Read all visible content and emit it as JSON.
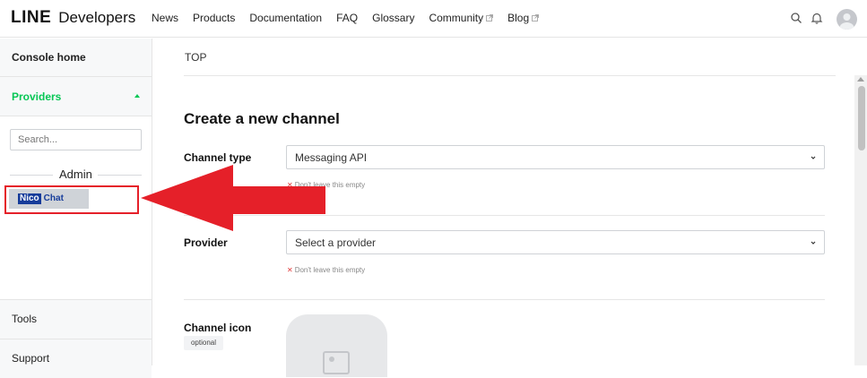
{
  "header": {
    "logo_line": "LINE",
    "logo_dev": "Developers",
    "nav": [
      {
        "label": "News"
      },
      {
        "label": "Products"
      },
      {
        "label": "Documentation"
      },
      {
        "label": "FAQ"
      },
      {
        "label": "Glossary"
      },
      {
        "label": "Community"
      },
      {
        "label": "Blog"
      }
    ]
  },
  "sidebar": {
    "console_home": "Console home",
    "providers": "Providers",
    "search_placeholder": "Search...",
    "admin": "Admin",
    "provider_logo": {
      "part_a": "Nico",
      "part_b": "Chat"
    },
    "tools": "Tools",
    "support": "Support"
  },
  "main": {
    "breadcrumb": "TOP",
    "title": "Create a new channel",
    "channel_type": {
      "label": "Channel type",
      "value": "Messaging API",
      "error": "Don't leave this empty"
    },
    "provider": {
      "label": "Provider",
      "value": "Select a provider",
      "error": "Don't leave this empty"
    },
    "channel_icon": {
      "label": "Channel icon",
      "badge": "optional"
    }
  },
  "colors": {
    "accent": "#06c755",
    "annotation": "#e52029",
    "error": "#e03c3c"
  }
}
